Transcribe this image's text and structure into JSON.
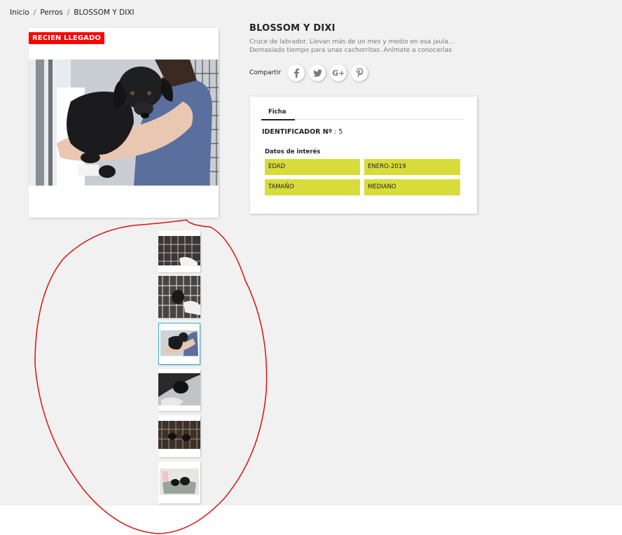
{
  "breadcrumb": [
    "Inicio",
    "Perros",
    "BLOSSOM Y DIXI"
  ],
  "product": {
    "flag": "RECIEN LLEGADO",
    "title": "BLOSSOM Y DIXI",
    "description": "Cruce de labrador. Llevan más de un mes y medio en esa jaula... Demasiado tiempo para unas cachorritas. Anímate a conocerlas",
    "thumbnails_count": 6,
    "selected_thumbnail": 3
  },
  "share": {
    "label": "Compartir",
    "buttons": [
      "facebook-icon",
      "twitter-icon",
      "google-plus-icon",
      "pinterest-icon"
    ],
    "google_plus_text": "G+"
  },
  "ficha": {
    "tab_label": "Ficha",
    "identifier_label": "IDENTIFICADOR Nº",
    "identifier_value": ": 5",
    "features_title": "Datos de interés",
    "features": [
      {
        "name": "EDAD",
        "value": "ENERO-2019"
      },
      {
        "name": "TAMAÑO",
        "value": "MEDIANO"
      }
    ]
  },
  "colors": {
    "flag_bg": "#ff0000",
    "feature_bg": "#d8dc3a",
    "selected_thumb_border": "#2fb5d2",
    "annotation": "#e01010"
  }
}
